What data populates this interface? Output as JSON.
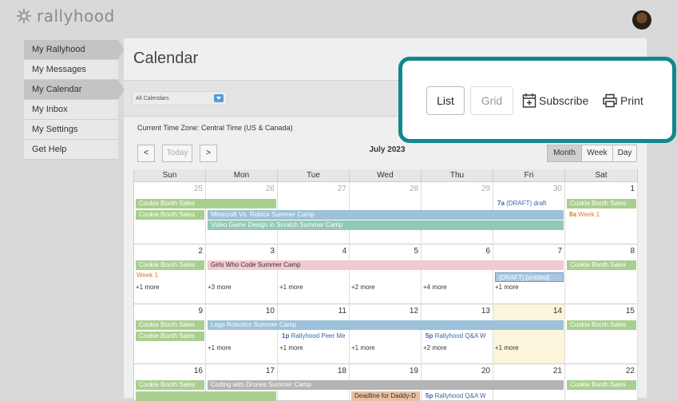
{
  "app": {
    "logo": "rallyhood"
  },
  "sidebar": {
    "items": [
      {
        "label": "My Rallyhood",
        "active": true
      },
      {
        "label": "My Messages",
        "active": false
      },
      {
        "label": "My Calendar",
        "active": true
      },
      {
        "label": "My Inbox",
        "active": false
      },
      {
        "label": "My Settings",
        "active": false
      },
      {
        "label": "Get Help",
        "active": false
      }
    ]
  },
  "page": {
    "title": "Calendar"
  },
  "toolbar": {
    "calendar_select": "All Calendars",
    "timezone": "Current Time Zone: Central Time (US & Canada)"
  },
  "nav": {
    "prev": "<",
    "today": "Today",
    "next": ">",
    "month_label": "July 2023"
  },
  "views": {
    "month": "Month",
    "week": "Week",
    "day": "Day",
    "active": "Month"
  },
  "popup": {
    "list": "List",
    "grid": "Grid",
    "subscribe": "Subscribe",
    "print": "Print",
    "accent": "#12878f"
  },
  "calendar": {
    "days": [
      "Sun",
      "Mon",
      "Tue",
      "Wed",
      "Thu",
      "Fri",
      "Sat"
    ],
    "weeks": [
      {
        "dates": [
          "25",
          "26",
          "27",
          "28",
          "29",
          "30",
          "1"
        ]
      },
      {
        "dates": [
          "2",
          "3",
          "4",
          "5",
          "6",
          "7",
          "8"
        ]
      },
      {
        "dates": [
          "9",
          "10",
          "11",
          "12",
          "13",
          "14",
          "15"
        ]
      },
      {
        "dates": [
          "16",
          "17",
          "18",
          "19",
          "20",
          "21",
          "22"
        ]
      }
    ],
    "events": {
      "cookie": "Cookie Booth Sales",
      "minecraft": "Minecraft Vs. Roblox Summer Camp",
      "videogame": "Video Game Design in Scratch Summer Camp",
      "draft_time": "7a",
      "draft_label": "(DRAFT) draft",
      "week1_time": "8a",
      "week1_label": "Week 1",
      "girls": "Girls Who Code Summer Camp",
      "week1b": "Week 1",
      "draft_untitled": "[DRAFT] [untitled]",
      "lego": "Lego Robotics Summer Camp",
      "peer_time": "1p",
      "peer_label": "Rallyhood Peer Me",
      "qa_time": "5p",
      "qa_label": "Rallyhood Q&A W",
      "drones": "Coding with Drones Summer Camp",
      "deadline": "Deadline for Daddy-D",
      "qa2_time": "5p",
      "qa2_label": "Rallyhood Q&A W"
    },
    "more": {
      "w2": [
        "+1 more",
        "+3 more",
        "+1 more",
        "+2 more",
        "+4 more",
        "+1 more"
      ],
      "w3": [
        "+1 more",
        "+1 more",
        "+1 more",
        "+2 more",
        "+1 more"
      ]
    }
  }
}
